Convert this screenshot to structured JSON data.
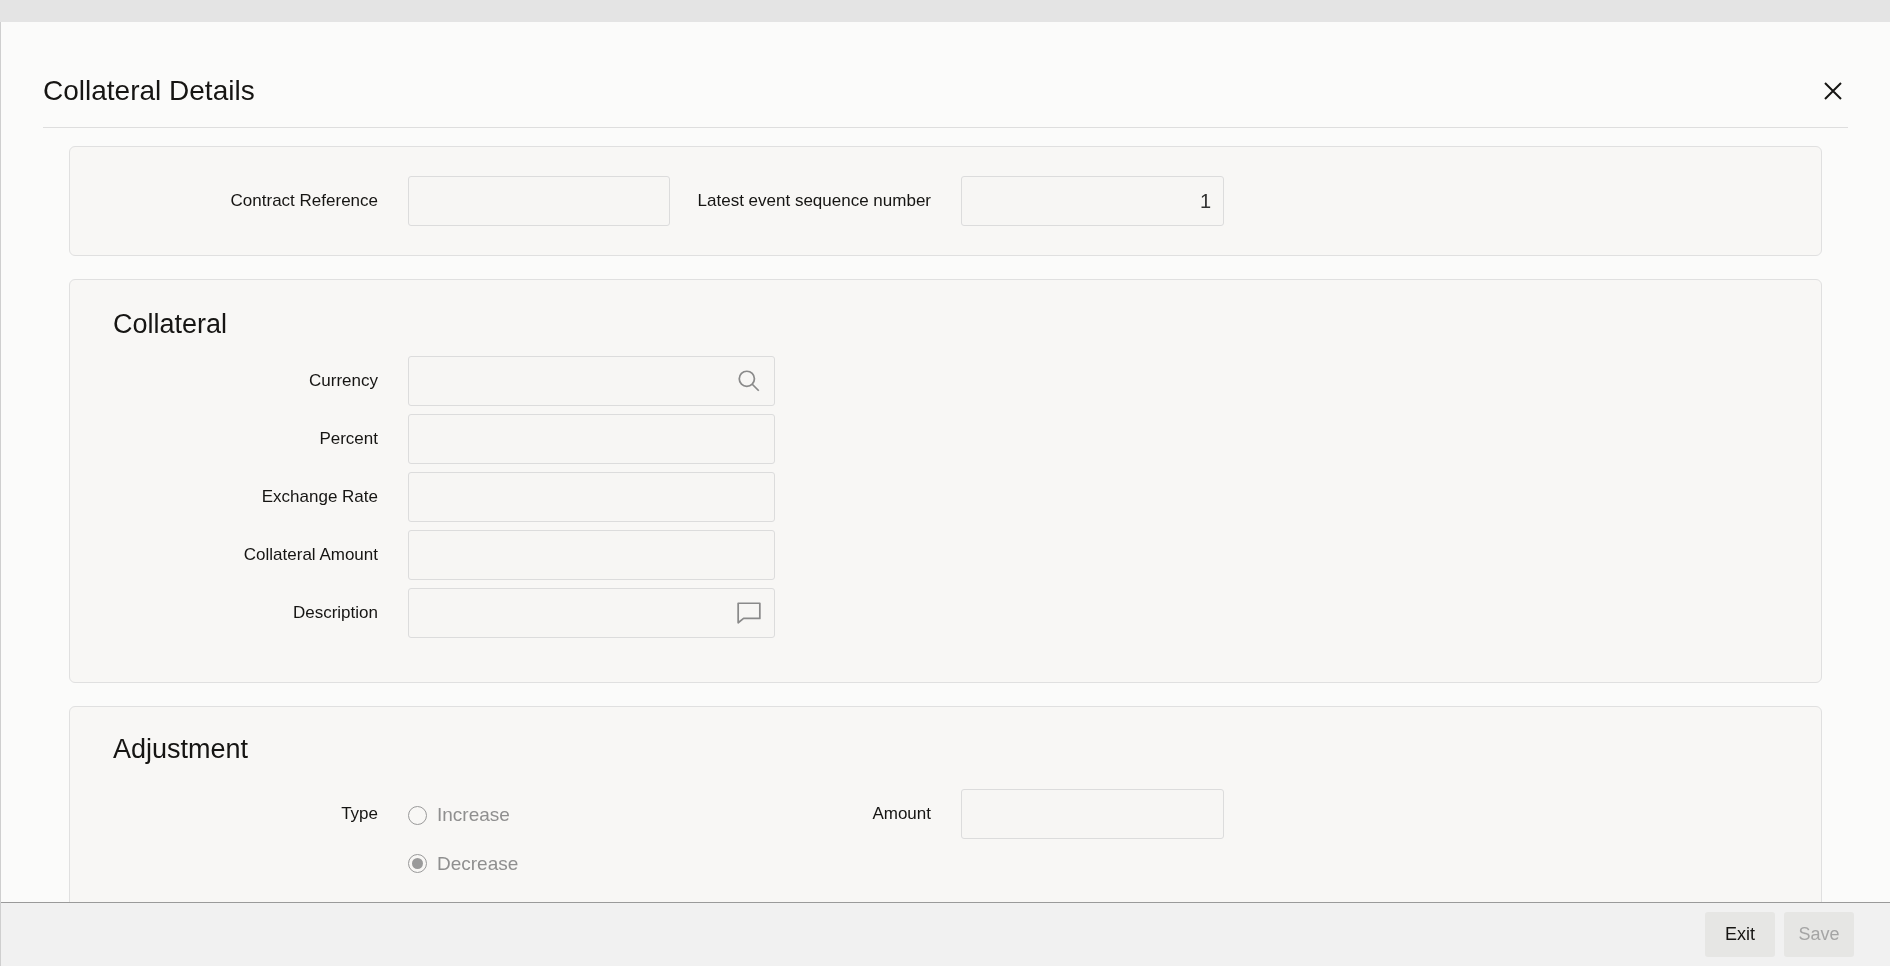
{
  "dialog": {
    "title": "Collateral Details"
  },
  "header_fields": [
    {
      "label": "Contract Reference"
    },
    {
      "label": "Latest event sequence number",
      "value": "1"
    }
  ],
  "collateral": {
    "heading": "Collateral",
    "fields": [
      {
        "label": "Currency",
        "kind": "lookup"
      },
      {
        "label": "Percent",
        "kind": "text"
      },
      {
        "label": "Exchange Rate",
        "kind": "text"
      },
      {
        "label": "Collateral Amount",
        "kind": "text"
      },
      {
        "label": "Description",
        "kind": "note"
      }
    ]
  },
  "adjustment": {
    "heading": "Adjustment",
    "type_label": "Type",
    "disabled": true,
    "options": [
      {
        "label": "Increase",
        "selected": false
      },
      {
        "label": "Decrease",
        "selected": true
      }
    ],
    "amount_label": "Amount"
  },
  "buttons": [
    {
      "label": "Exit",
      "disabled": false
    },
    {
      "label": "Save",
      "disabled": true
    }
  ]
}
